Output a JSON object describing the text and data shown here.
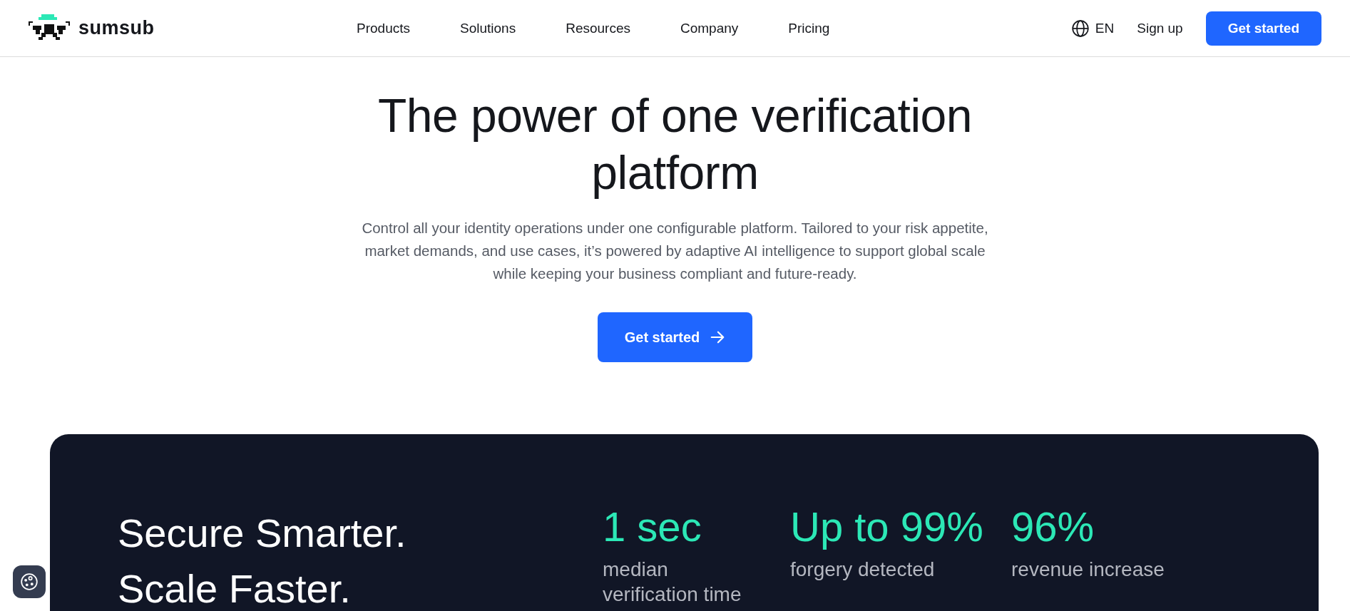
{
  "header": {
    "logo_text": "sumsub",
    "nav": [
      "Products",
      "Solutions",
      "Resources",
      "Company",
      "Pricing"
    ],
    "language": "EN",
    "sign_up": "Sign up",
    "cta": "Get started"
  },
  "hero": {
    "title": "The power of one verification platform",
    "description": "Control all your identity operations under one configurable platform. Tailored to your risk appetite, market demands, and use cases, it’s powered by adaptive AI intelligence to support global scale while keeping your business compliant and future-ready.",
    "cta": "Get started"
  },
  "stats_card": {
    "headline": [
      "Secure Smarter.",
      "Scale Faster."
    ],
    "stats": [
      {
        "value": "1 sec",
        "label": "median verification time"
      },
      {
        "value": "Up to 99%",
        "label": "forgery detected"
      },
      {
        "value": "96%",
        "label": "revenue increase"
      }
    ]
  }
}
